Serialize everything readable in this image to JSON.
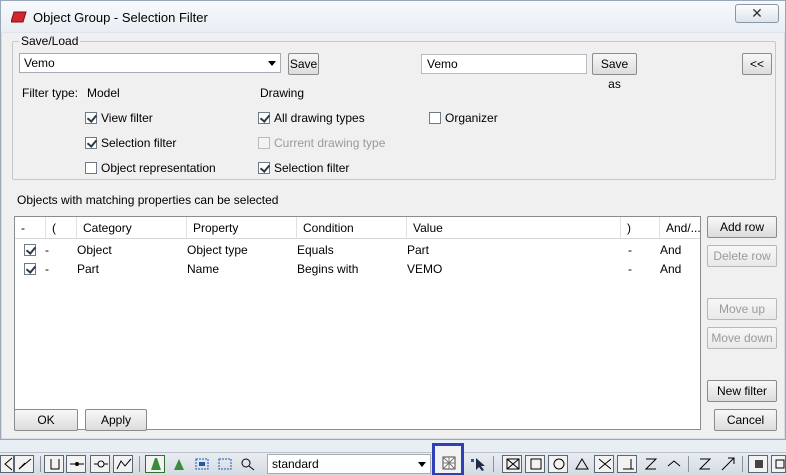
{
  "window": {
    "title": "Object Group - Selection Filter",
    "close_label": "✕"
  },
  "save_load": {
    "group_label": "Save/Load",
    "preset_value": "Vemo",
    "save_label": "Save",
    "name_value": "Vemo",
    "save_as_label": "Save as",
    "collapse_label": "<<"
  },
  "filter_type": {
    "label": "Filter type:",
    "model_heading": "Model",
    "drawing_heading": "Drawing",
    "model_options": [
      {
        "label": "View filter",
        "checked": true
      },
      {
        "label": "Selection filter",
        "checked": true
      },
      {
        "label": "Object representation",
        "checked": false
      }
    ],
    "drawing_options": [
      {
        "label": "All drawing types",
        "checked": true
      },
      {
        "label": "Current drawing type",
        "checked": false,
        "disabled": true
      },
      {
        "label": "Selection filter",
        "checked": true
      }
    ],
    "organizer": {
      "label": "Organizer",
      "checked": false
    }
  },
  "rules": {
    "caption": "Objects with matching properties can be selected",
    "columns": [
      "-",
      "(",
      "Category",
      "Property",
      "Condition",
      "Value",
      ")",
      "And/..."
    ],
    "rows": [
      {
        "checked": true,
        "open": "-",
        "category": "Object",
        "property": "Object type",
        "condition": "Equals",
        "value": "Part",
        "close": "-",
        "andor": "And"
      },
      {
        "checked": true,
        "open": "-",
        "category": "Part",
        "property": "Name",
        "condition": "Begins with",
        "value": "VEMO",
        "close": "-",
        "andor": "And"
      }
    ]
  },
  "side_buttons": {
    "add_row": "Add row",
    "delete_row": "Delete row",
    "move_up": "Move up",
    "move_down": "Move down",
    "new_filter": "New filter"
  },
  "footer": {
    "ok": "OK",
    "apply": "Apply",
    "cancel": "Cancel"
  },
  "bottom_toolbar": {
    "representation_value": "standard"
  },
  "colors": {
    "dialog_bg": "#f0f0f0",
    "highlight_box": "#2f3fb8",
    "title_icon": "#d0262c"
  }
}
